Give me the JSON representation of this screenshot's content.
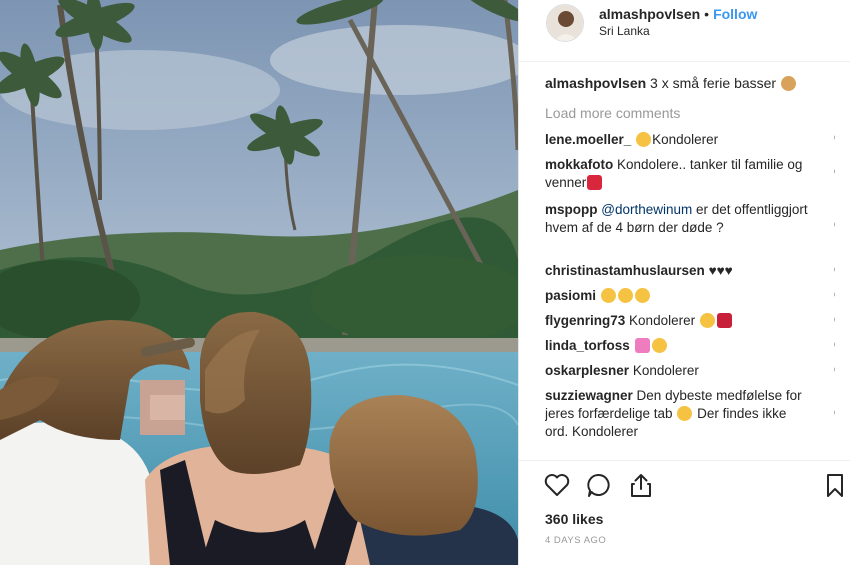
{
  "header": {
    "username": "almashpovlsen",
    "dot": "•",
    "follow_label": "Follow",
    "location": "Sri Lanka"
  },
  "caption": {
    "username": "almashpovlsen",
    "text": "3 x små ferie basser"
  },
  "load_more_label": "Load more comments",
  "comments": [
    {
      "user": "lene.moeller_",
      "text": "Kondolerer"
    },
    {
      "user": "mokkafoto",
      "text": "Kondolere.. tanker til familie og venner"
    },
    {
      "user": "mspopp",
      "mention": "@dorthewinum",
      "text": "er det offentliggjort hvem af de 4 børn der døde ?"
    },
    {
      "user": "christinastamhuslaursen",
      "text": "♥♥♥"
    },
    {
      "user": "pasiomi",
      "text": ""
    },
    {
      "user": "flygenring73",
      "text": "Kondolerer"
    },
    {
      "user": "linda_torfoss",
      "text": ""
    },
    {
      "user": "oskarplesner",
      "text": "Kondolerer"
    },
    {
      "user": "suzziewagner",
      "text": "Den dybeste medfølelse for jeres forfærdelige tab",
      "text2": "Der findes ikke ord. Kondolerer"
    }
  ],
  "likes": "360 likes",
  "timestamp": "4 DAYS AGO",
  "icons": [
    "heart-icon",
    "comment-icon",
    "share-icon",
    "bookmark-icon"
  ],
  "colors": {
    "link": "#3897f0",
    "text": "#262626",
    "muted": "#999999",
    "like_red": "#e0245e"
  }
}
